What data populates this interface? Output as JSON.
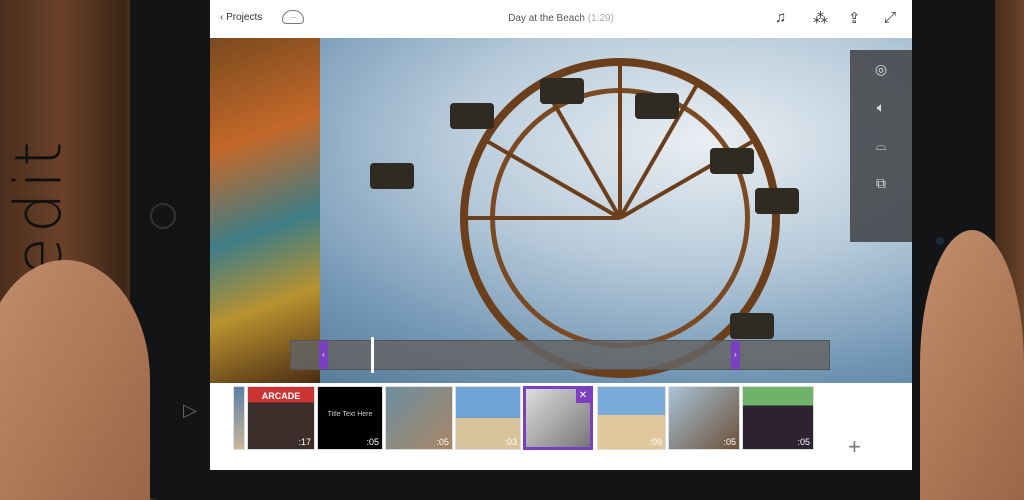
{
  "logo": "edit",
  "topbar": {
    "back_label": "Projects",
    "cloud_label": "...",
    "title": "Day at the Beach",
    "duration": "(1:29)"
  },
  "icons": {
    "music": "music-icon",
    "magic": "magic-wand-icon",
    "share": "share-icon",
    "fullscreen": "expand-icon"
  },
  "side_tools": [
    "aperture-icon",
    "speaker-icon",
    "car-speed-icon",
    "overlay-icon"
  ],
  "clips": [
    {
      "label": "",
      "duration": ""
    },
    {
      "label": "ARCADE",
      "duration": ":17"
    },
    {
      "label": "Title Text Here",
      "duration": ":05"
    },
    {
      "label": "",
      "duration": ":05"
    },
    {
      "label": "",
      "duration": ":03"
    },
    {
      "label": "",
      "duration": "",
      "selected": true
    },
    {
      "label": "",
      "duration": ":09"
    },
    {
      "label": "",
      "duration": ":05"
    },
    {
      "label": "",
      "duration": ":05"
    }
  ],
  "accent": "#7b3fbf"
}
